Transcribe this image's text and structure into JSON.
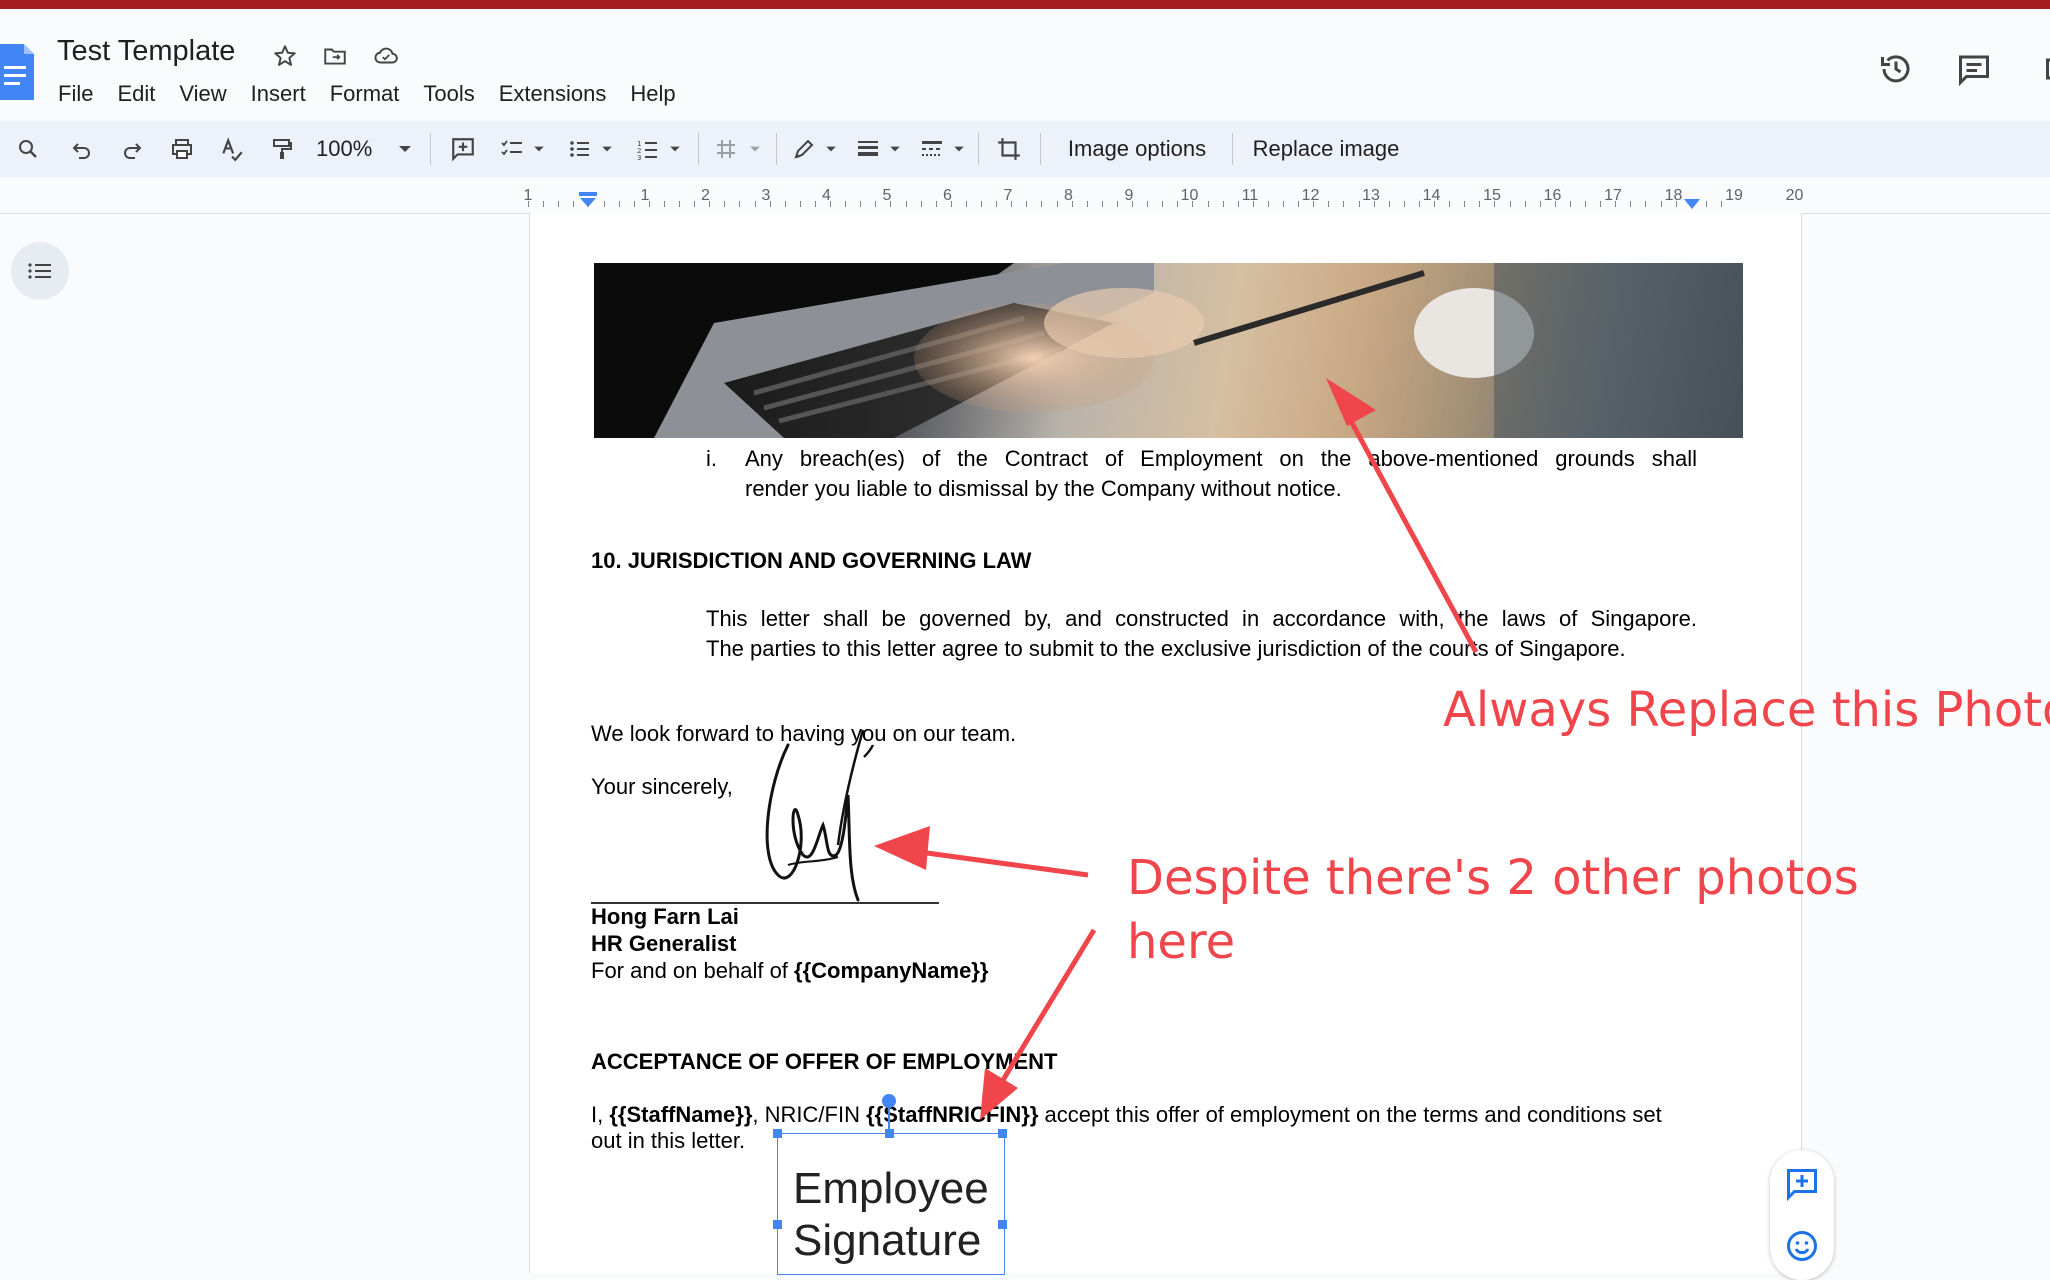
{
  "app": {
    "title": "Test Template",
    "menu": [
      "File",
      "Edit",
      "View",
      "Insert",
      "Format",
      "Tools",
      "Extensions",
      "Help"
    ]
  },
  "toolbar": {
    "zoom": "100%",
    "image_options": "Image options",
    "replace_image": "Replace image"
  },
  "ruler": {
    "labels": [
      "1",
      "1",
      "2",
      "3",
      "4",
      "5",
      "6",
      "7",
      "8",
      "9",
      "10",
      "11",
      "12",
      "13",
      "14",
      "15",
      "16",
      "17",
      "18",
      "19",
      "20"
    ]
  },
  "document": {
    "list_marker": "i.",
    "breach_line1": "Any breach(es) of the Contract of Employment on the above-mentioned grounds shall",
    "breach_line2": "render you liable to dismissal by the Company without notice.",
    "section10_heading": "10. JURISDICTION AND GOVERNING LAW",
    "law_line1": "This letter shall be governed by, and constructed in accordance with, the laws of Singapore.",
    "law_line2": "The parties to this letter agree to submit to the exclusive jurisdiction of the courts of Singapore.",
    "team_line": "We look forward to having you on our team.",
    "sincerely": "Your sincerely,",
    "signer_name": "Hong Farn Lai",
    "signer_title": "HR Generalist",
    "behalf_prefix": "For and on behalf of ",
    "behalf_company": "{{CompanyName}}",
    "acceptance_heading": "ACCEPTANCE OF OFFER OF EMPLOYMENT",
    "accept_i": "I, ",
    "accept_staffname": "{{StaffName}}",
    "accept_nric": ", NRIC/FIN ",
    "accept_staffnric": "{{StaffNRICFIN}}",
    "accept_rest": " accept this offer of employment on the terms and conditions set",
    "accept_line2": "out in this letter.",
    "employee_sig_line1": "Employee",
    "employee_sig_line2": "Signature"
  },
  "annotations": {
    "always_replace": "Always Replace this Photo",
    "despite_line1": "Despite there's 2 other photos",
    "despite_line2": "here",
    "color": "#f0454a"
  },
  "colors": {
    "accent": "#1a73e8",
    "selection": "#4285f4",
    "top_stripe": "#a51d1d"
  }
}
